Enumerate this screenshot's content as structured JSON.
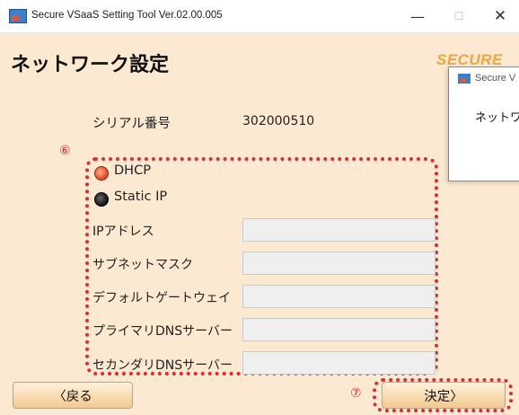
{
  "window": {
    "title": "Secure VSaaS Setting Tool  Ver.02.00.005",
    "minimize": "—",
    "maximize": "☐",
    "close": "✕"
  },
  "page": {
    "heading": "ネットワーク設定",
    "logo_text": "SECURE"
  },
  "popup": {
    "title": "Secure V",
    "text": "ネットワ"
  },
  "serial": {
    "label": "シリアル番号",
    "value": "302000510"
  },
  "markers": {
    "network_section": "⑥",
    "confirm_button": "⑦"
  },
  "network": {
    "options": [
      {
        "label": "DHCP",
        "selected": true
      },
      {
        "label": "Static IP",
        "selected": false
      }
    ],
    "fields": [
      {
        "label": "IPアドレス",
        "value": ""
      },
      {
        "label": "サブネットマスク",
        "value": ""
      },
      {
        "label": "デフォルトゲートウェイ",
        "value": ""
      },
      {
        "label": "プライマリDNSサーバー",
        "value": ""
      },
      {
        "label": "セカンダリDNSサーバー",
        "value": ""
      }
    ]
  },
  "buttons": {
    "back": "〈戻る",
    "confirm": "決定〉"
  },
  "colors": {
    "background": "#fce9d2",
    "annotation": "#e8262b",
    "button_gradient_bottom": "#f3c98e"
  }
}
